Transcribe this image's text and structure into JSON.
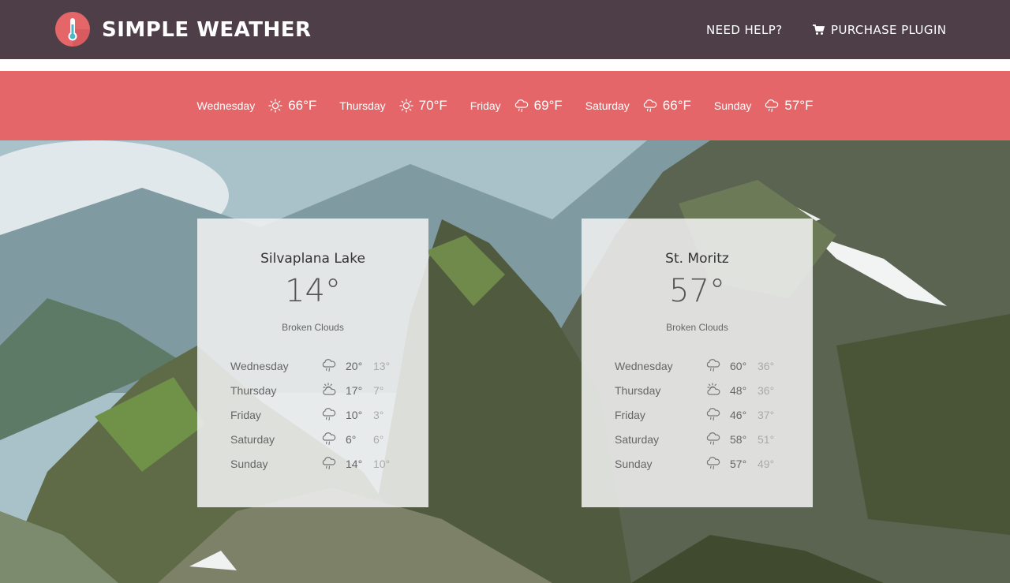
{
  "header": {
    "brand": "SIMPLE WEATHER",
    "nav": {
      "help": "NEED HELP?",
      "purchase": "PURCHASE PLUGIN"
    },
    "colors": {
      "background": "#4e3e47",
      "logo": "#e46668"
    }
  },
  "forecast_strip": {
    "color": "#e46668",
    "days": [
      {
        "day": "Wednesday",
        "icon": "sun-icon",
        "temp": "66°F"
      },
      {
        "day": "Thursday",
        "icon": "sun-icon",
        "temp": "70°F"
      },
      {
        "day": "Friday",
        "icon": "rain-cloud-icon",
        "temp": "69°F"
      },
      {
        "day": "Saturday",
        "icon": "rain-cloud-icon",
        "temp": "66°F"
      },
      {
        "day": "Sunday",
        "icon": "rain-cloud-icon",
        "temp": "57°F"
      }
    ]
  },
  "cards": [
    {
      "city": "Silvaplana Lake",
      "temp": "14°",
      "condition": "Broken Clouds",
      "days": [
        {
          "day": "Wednesday",
          "icon": "rain-cloud-icon",
          "high": "20°",
          "low": "13°"
        },
        {
          "day": "Thursday",
          "icon": "partly-cloudy-icon",
          "high": "17°",
          "low": "7°"
        },
        {
          "day": "Friday",
          "icon": "rain-cloud-icon",
          "high": "10°",
          "low": "3°"
        },
        {
          "day": "Saturday",
          "icon": "rain-cloud-icon",
          "high": "6°",
          "low": "6°"
        },
        {
          "day": "Sunday",
          "icon": "rain-cloud-icon",
          "high": "14°",
          "low": "10°"
        }
      ]
    },
    {
      "city": "St. Moritz",
      "temp": "57°",
      "condition": "Broken Clouds",
      "days": [
        {
          "day": "Wednesday",
          "icon": "rain-cloud-icon",
          "high": "60°",
          "low": "36°"
        },
        {
          "day": "Thursday",
          "icon": "partly-cloudy-icon",
          "high": "48°",
          "low": "36°"
        },
        {
          "day": "Friday",
          "icon": "rain-cloud-icon",
          "high": "46°",
          "low": "37°"
        },
        {
          "day": "Saturday",
          "icon": "rain-cloud-icon",
          "high": "58°",
          "low": "51°"
        },
        {
          "day": "Sunday",
          "icon": "rain-cloud-icon",
          "high": "57°",
          "low": "49°"
        }
      ]
    }
  ]
}
